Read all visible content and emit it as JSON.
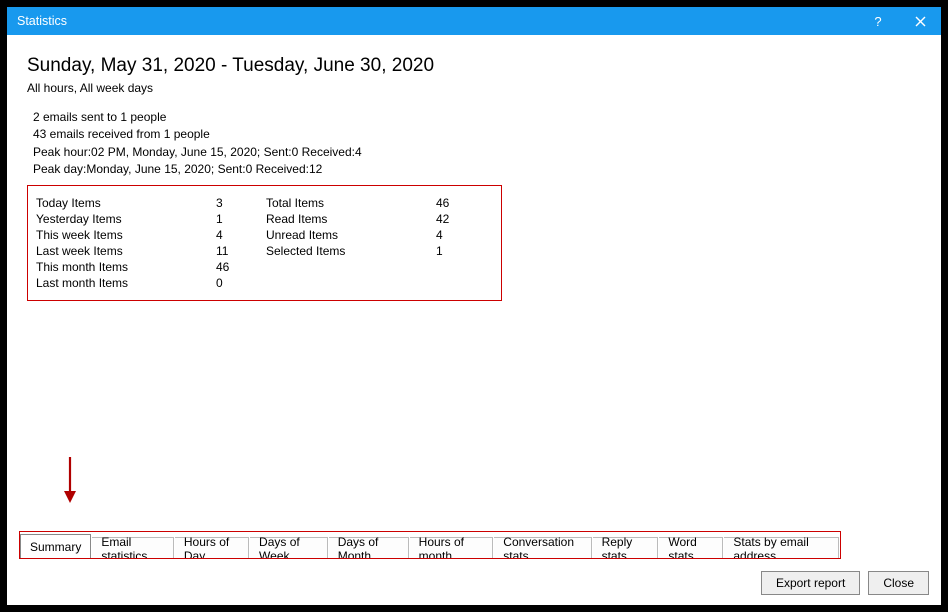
{
  "window": {
    "title": "Statistics"
  },
  "header": {
    "date_range": "Sunday, May 31, 2020 - Tuesday, June 30, 2020",
    "filter_desc": "All hours, All week days"
  },
  "summary_lines": {
    "l1": "2 emails sent to 1 people",
    "l2": "43 emails received from 1 people",
    "l3": "Peak hour:02 PM, Monday, June 15, 2020; Sent:0 Received:4",
    "l4": "Peak day:Monday, June 15, 2020; Sent:0 Received:12"
  },
  "stats": {
    "left": [
      {
        "label": "Today Items",
        "value": "3"
      },
      {
        "label": "Yesterday Items",
        "value": "1"
      },
      {
        "label": "This week Items",
        "value": "4"
      },
      {
        "label": "Last week Items",
        "value": "11"
      },
      {
        "label": "This month Items",
        "value": "46"
      },
      {
        "label": "Last month Items",
        "value": "0"
      }
    ],
    "right": [
      {
        "label": "Total Items",
        "value": "46"
      },
      {
        "label": "Read Items",
        "value": "42"
      },
      {
        "label": "Unread Items",
        "value": "4"
      },
      {
        "label": "Selected Items",
        "value": "1"
      }
    ]
  },
  "tabs": [
    "Summary",
    "Email statistics",
    "Hours of Day",
    "Days of Week",
    "Days of Month",
    "Hours of month",
    "Conversation stats",
    "Reply stats",
    "Word stats",
    "Stats by email address"
  ],
  "buttons": {
    "export": "Export report",
    "close": "Close"
  }
}
